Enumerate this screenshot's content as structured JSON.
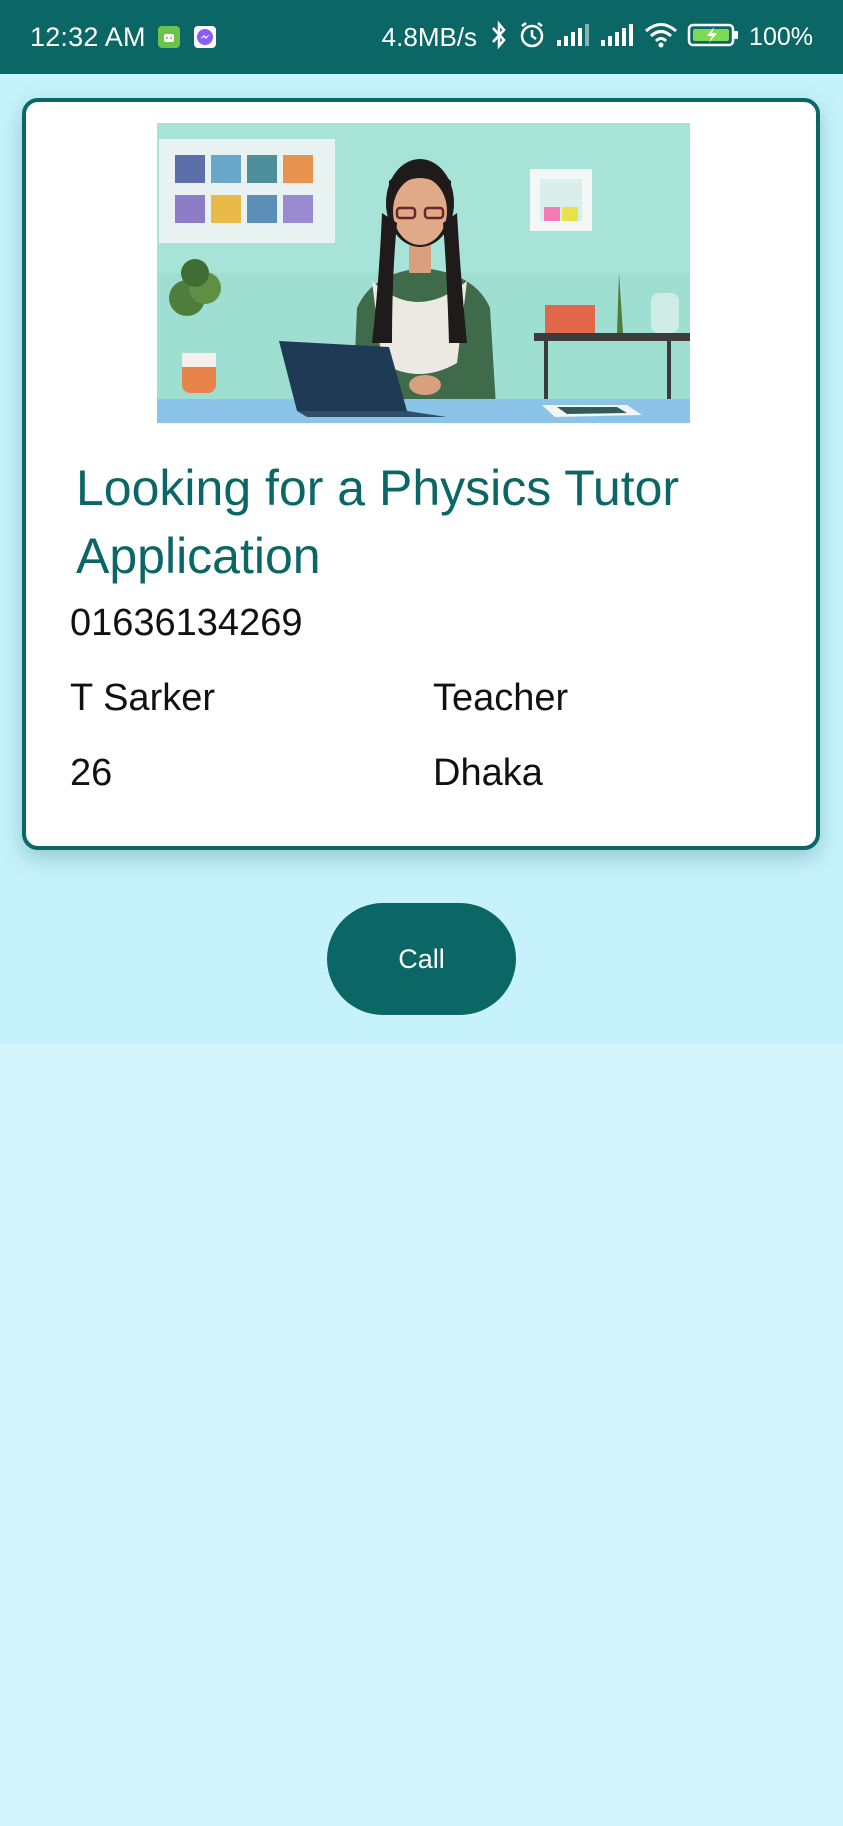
{
  "status_bar": {
    "time": "12:32 AM",
    "notification_icons": [
      "android-app-icon",
      "messenger-icon"
    ],
    "network_speed": "4.8MB/s",
    "system_icons": [
      "bluetooth-icon",
      "alarm-icon",
      "signal-icon",
      "signal-icon",
      "wifi-icon",
      "battery-charging-icon"
    ],
    "battery_percent": "100%"
  },
  "card": {
    "title": "Looking for a Physics Tutor Application",
    "phone": "01636134269",
    "name": "T Sarker",
    "profession": "Teacher",
    "age": "26",
    "location": "Dhaka"
  },
  "actions": {
    "call_label": "Call"
  },
  "colors": {
    "primary": "#0b6766",
    "background": "#d3f4fc",
    "upper_band": "#c6f2fb",
    "card": "#ffffff"
  }
}
